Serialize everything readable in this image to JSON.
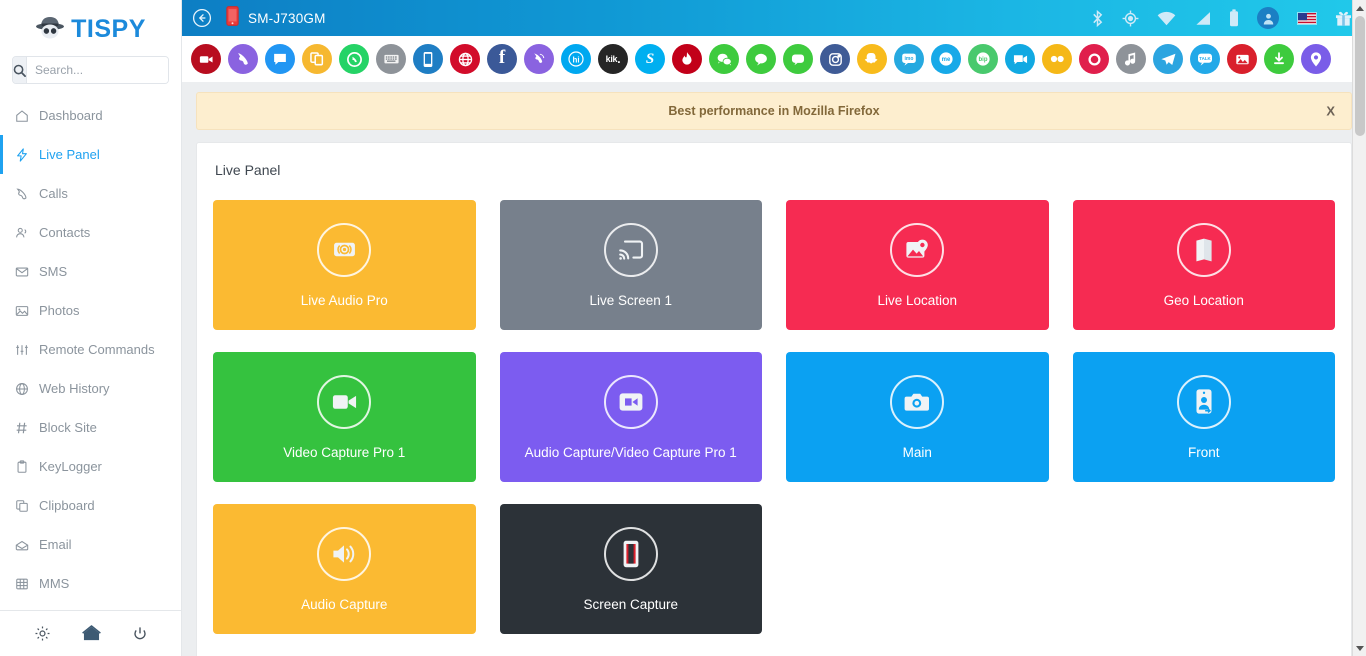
{
  "brand": {
    "name": "TISPY",
    "logo_icon": "spy-hat-icon"
  },
  "search": {
    "placeholder": "Search...",
    "value": "",
    "icon": "search-icon"
  },
  "sidebar": {
    "items": [
      {
        "label": "Dashboard",
        "icon": "home-icon",
        "active": false
      },
      {
        "label": "Live Panel",
        "icon": "bolt-icon",
        "active": true
      },
      {
        "label": "Calls",
        "icon": "phone-icon",
        "active": false
      },
      {
        "label": "Contacts",
        "icon": "contacts-icon",
        "active": false
      },
      {
        "label": "SMS",
        "icon": "envelope-icon",
        "active": false
      },
      {
        "label": "Photos",
        "icon": "photo-icon",
        "active": false
      },
      {
        "label": "Remote Commands",
        "icon": "sliders-icon",
        "active": false
      },
      {
        "label": "Web History",
        "icon": "globe-icon",
        "active": false
      },
      {
        "label": "Block Site",
        "icon": "hash-icon",
        "active": false
      },
      {
        "label": "KeyLogger",
        "icon": "clipboard-icon",
        "active": false
      },
      {
        "label": "Clipboard",
        "icon": "copy-icon",
        "active": false
      },
      {
        "label": "Email",
        "icon": "mail-open-icon",
        "active": false
      },
      {
        "label": "MMS",
        "icon": "grid-icon",
        "active": false
      }
    ],
    "footer": [
      {
        "name": "settings-button",
        "icon": "gear-icon"
      },
      {
        "name": "home-button",
        "icon": "house-icon"
      },
      {
        "name": "power-button",
        "icon": "power-icon"
      }
    ]
  },
  "topbar": {
    "back_icon": "back-arrow-icon",
    "device_icon": "mobile-phone-icon",
    "device_name": "SM-J730GM",
    "status_icons": [
      "bluetooth-icon",
      "location-icon",
      "wifi-icon",
      "signal-icon",
      "battery-icon",
      "user-avatar-icon",
      "us-flag-icon",
      "gift-icon"
    ],
    "gradient_from": "#0d7ec4",
    "gradient_to": "#21c9ea"
  },
  "app_bar": {
    "apps": [
      {
        "name": "video-recorder",
        "glyph": "▶",
        "color": "#b80d1f"
      },
      {
        "name": "phone-call",
        "glyph": "☎",
        "color": "#8a63e0"
      },
      {
        "name": "messages",
        "glyph": "▭",
        "color": "#2196f3"
      },
      {
        "name": "duplicate-apps",
        "glyph": "❐",
        "color": "#f6b830"
      },
      {
        "name": "whatsapp",
        "glyph": "✆",
        "color": "#25d366"
      },
      {
        "name": "keyboard",
        "glyph": "⌨",
        "color": "#8e9399"
      },
      {
        "name": "mobile-device",
        "glyph": "▯",
        "color": "#1f7ec4"
      },
      {
        "name": "browser-globe",
        "glyph": "⊕",
        "color": "#d20c2a"
      },
      {
        "name": "facebook",
        "glyph": "f",
        "color": "#3b5998"
      },
      {
        "name": "viber",
        "glyph": "✆",
        "color": "#8a63e0"
      },
      {
        "name": "hike",
        "glyph": "hi",
        "color": "#00a8f0"
      },
      {
        "name": "kik",
        "glyph": "kik",
        "color": "#262626"
      },
      {
        "name": "skype",
        "glyph": "S",
        "color": "#00aff0"
      },
      {
        "name": "tinder",
        "glyph": "ὒ5",
        "color": "#c20019"
      },
      {
        "name": "wechat",
        "glyph": "◔",
        "color": "#3ecb3e"
      },
      {
        "name": "kakaotalk",
        "glyph": "●",
        "color": "#3ecb3e"
      },
      {
        "name": "line",
        "glyph": "▢",
        "color": "#3ecb3e"
      },
      {
        "name": "instagram",
        "glyph": "▣",
        "color": "#3f5b96"
      },
      {
        "name": "snapchat",
        "glyph": "◑",
        "color": "#f8bb1c"
      },
      {
        "name": "imo",
        "glyph": "imo",
        "color": "#26a9e0"
      },
      {
        "name": "mewe",
        "glyph": "me",
        "color": "#17a9e8"
      },
      {
        "name": "bip",
        "glyph": "bip",
        "color": "#49c96d"
      },
      {
        "name": "video-chat",
        "glyph": "▷",
        "color": "#11a9e2"
      },
      {
        "name": "flickr",
        "glyph": "●●",
        "color": "#f5b817"
      },
      {
        "name": "badoo",
        "glyph": "◯",
        "color": "#e01f4c"
      },
      {
        "name": "music",
        "glyph": "♪",
        "color": "#8e9399"
      },
      {
        "name": "telegram",
        "glyph": "➤",
        "color": "#2ca5e0"
      },
      {
        "name": "talk",
        "glyph": "TALK",
        "color": "#22a9e8"
      },
      {
        "name": "gallery",
        "glyph": "⛰",
        "color": "#d9202c"
      },
      {
        "name": "downloads",
        "glyph": "↓",
        "color": "#3ecb3e"
      },
      {
        "name": "location-pin",
        "glyph": "●",
        "color": "#7a5de8"
      }
    ]
  },
  "banner": {
    "text": "Best performance in Mozilla Firefox",
    "close_label": "X",
    "bg": "#fdeecf",
    "text_color": "#82683a"
  },
  "main": {
    "panel_title": "Live Panel",
    "cards": [
      {
        "label": "Live Audio Pro",
        "icon": "broadcast-icon",
        "color": "#fbba32"
      },
      {
        "label": "Live Screen 1",
        "icon": "screen-cast-icon",
        "color": "#77808c"
      },
      {
        "label": "Live Location",
        "icon": "map-pin-photo-icon",
        "color": "#f62b52"
      },
      {
        "label": "Geo Location",
        "icon": "folded-map-icon",
        "color": "#f62b52"
      },
      {
        "label": "Video Capture Pro 1",
        "icon": "video-camera-icon",
        "color": "#35c23f"
      },
      {
        "label": "Audio Capture/Video Capture Pro 1",
        "icon": "video-box-icon",
        "color": "#7c5cf0"
      },
      {
        "label": "Main",
        "icon": "camera-icon",
        "color": "#0ba1f2"
      },
      {
        "label": "Front",
        "icon": "selfie-phone-icon",
        "color": "#0ba1f2"
      },
      {
        "label": "Audio Capture",
        "icon": "speaker-icon",
        "color": "#fbba32"
      },
      {
        "label": "Screen Capture",
        "icon": "phone-screen-icon",
        "color": "#2c3238"
      }
    ]
  },
  "scrollbar": {
    "up_icon": "scroll-up-arrow-icon",
    "down_icon": "scroll-down-arrow-icon"
  }
}
